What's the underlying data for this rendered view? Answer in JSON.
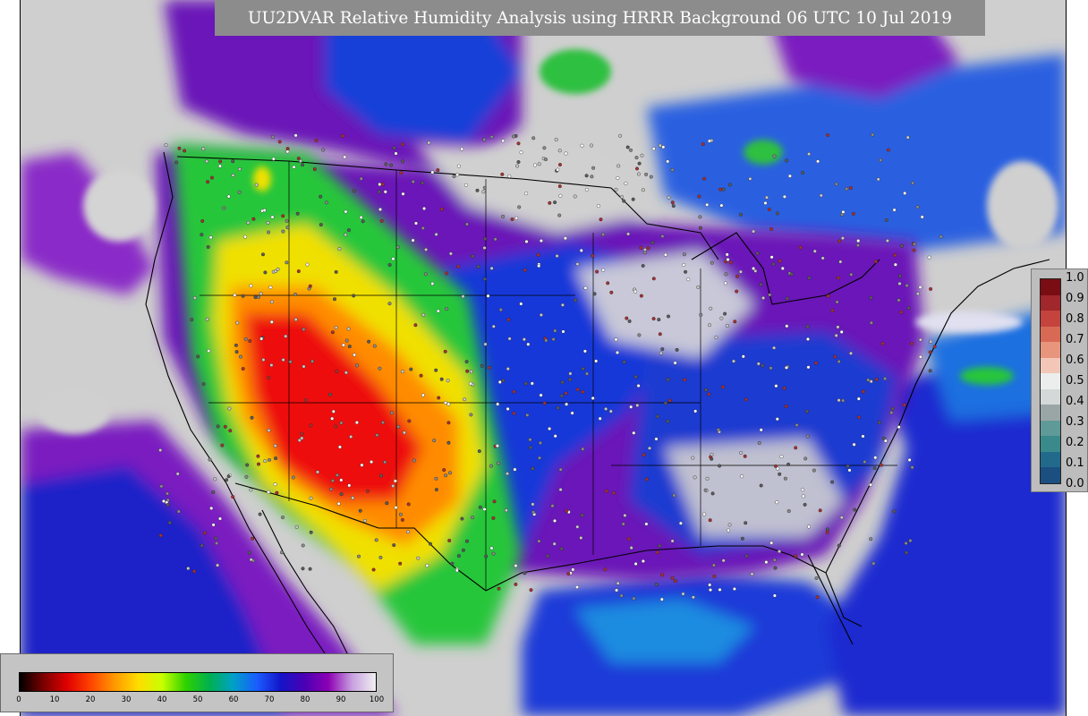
{
  "title": "UU2DVAR Relative Humidity Analysis using HRRR Background 06 UTC 10 Jul 2019",
  "rh_legend": {
    "labels": [
      "1.0",
      "0.9",
      "0.8",
      "0.7",
      "0.6",
      "0.5",
      "0.4",
      "0.3",
      "0.2",
      "0.1",
      "0.0"
    ],
    "colors": [
      "#7a0c14",
      "#a0272b",
      "#c4433d",
      "#d86a55",
      "#e8957e",
      "#f2c7b8",
      "#eceeee",
      "#d4d8d8",
      "#9aa6a6",
      "#5f9a98",
      "#3a8a8c",
      "#226a8c",
      "#1b4f80"
    ]
  },
  "percent_legend": {
    "ticks": [
      "0",
      "10",
      "20",
      "30",
      "40",
      "50",
      "60",
      "70",
      "80",
      "90",
      "100"
    ],
    "gradient_colors": [
      "#000000",
      "#7a0000",
      "#e00000",
      "#ff4400",
      "#ff9900",
      "#ffdd00",
      "#c8ff00",
      "#2ed100",
      "#00b050",
      "#00a0c8",
      "#1a5cff",
      "#1414c8",
      "#4b00b4",
      "#8c00b4",
      "#c8a0e0",
      "#f0f0f0"
    ]
  },
  "map_colors": {
    "background": "#cfcfcf",
    "ocean_deep": "#1d22c8",
    "moist": "#6a12b8",
    "very_moist": "#d8d0e8",
    "mid": "#0a7dd8",
    "green": "#25c63a",
    "yellow": "#f0e000",
    "orange": "#ff8c00",
    "red": "#ee1010"
  }
}
